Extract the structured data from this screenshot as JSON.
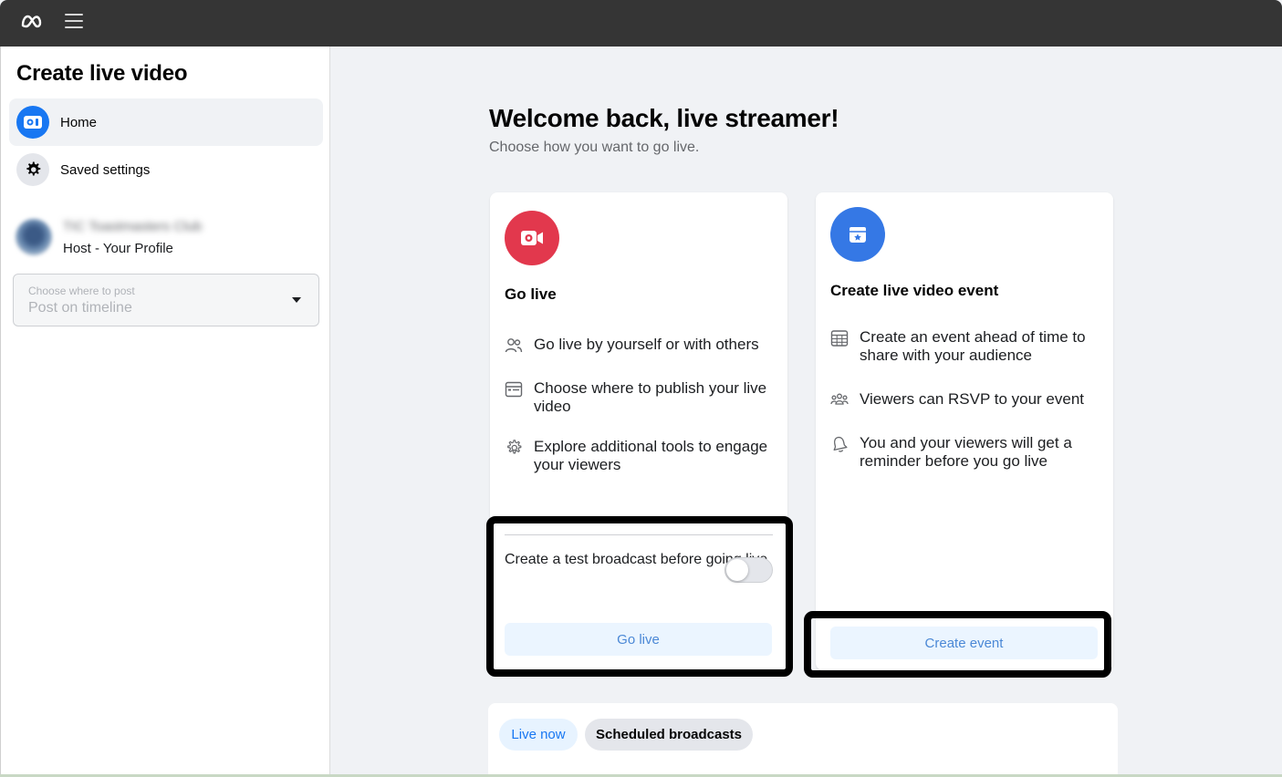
{
  "topbar": {
    "logo_icon": "meta-logo-icon",
    "menu_icon": "hamburger-menu-icon"
  },
  "sidebar": {
    "title": "Create live video",
    "items": [
      {
        "label": "Home",
        "icon": "live-video-camera-icon",
        "active": true
      },
      {
        "label": "Saved settings",
        "icon": "gear-icon",
        "active": false
      }
    ],
    "profile": {
      "name": "TIC Toastmasters Club",
      "role": "Host - Your Profile"
    },
    "post_select": {
      "label": "Choose where to post",
      "value": "Post on timeline"
    }
  },
  "main": {
    "heading": "Welcome back, live streamer!",
    "subheading": "Choose how you want to go live.",
    "go_live_card": {
      "title": "Go live",
      "features": [
        {
          "icon": "people-icon",
          "text": "Go live by yourself or with others"
        },
        {
          "icon": "browser-window-icon",
          "text": "Choose where to publish your live video"
        },
        {
          "icon": "gear-outline-icon",
          "text": "Explore additional tools to engage your viewers"
        }
      ],
      "toggle_label": "Create a test broadcast before going live",
      "toggle_on": false,
      "button_label": "Go live"
    },
    "event_card": {
      "title": "Create live video event",
      "features": [
        {
          "icon": "calendar-grid-icon",
          "text": "Create an event ahead of time to share with your audience"
        },
        {
          "icon": "group-icon",
          "text": "Viewers can RSVP to your event"
        },
        {
          "icon": "bell-icon",
          "text": "You and your viewers will get a reminder before you go live"
        }
      ],
      "button_label": "Create event"
    },
    "tabs": [
      {
        "label": "Live now",
        "active": true
      },
      {
        "label": "Scheduled broadcasts",
        "active": false
      }
    ]
  },
  "colors": {
    "accent": "#1877f2",
    "go_live_red": "#e2384d",
    "event_blue": "#3578e5",
    "topbar": "#353535"
  }
}
